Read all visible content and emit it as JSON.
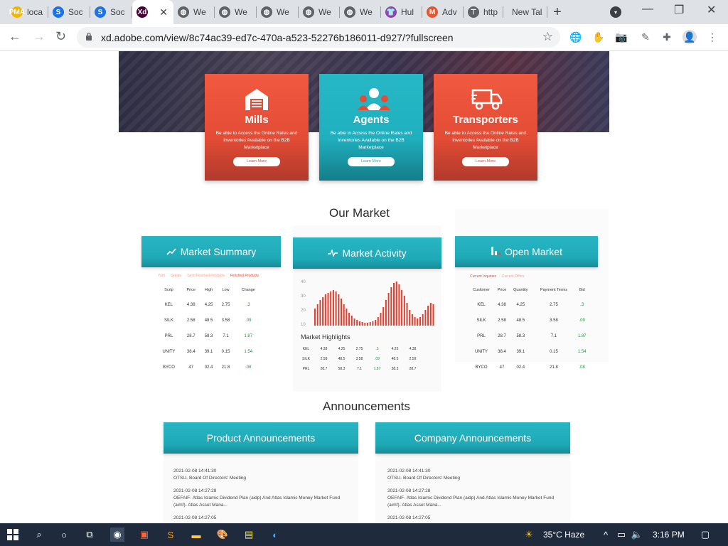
{
  "browser": {
    "tabs": [
      {
        "title": "loca",
        "icon": "pma-icon",
        "color": "#f4b400",
        "letter": "PMA"
      },
      {
        "title": "Soc",
        "icon": "s-icon",
        "color": "#1a73e8",
        "letter": "S"
      },
      {
        "title": "Soc",
        "icon": "s-icon",
        "color": "#1a73e8",
        "letter": "S"
      },
      {
        "title": "",
        "icon": "xd-icon",
        "color": "#470137",
        "letter": "Xd",
        "active": true
      },
      {
        "title": "We",
        "icon": "globe-icon",
        "color": "#5f6368",
        "letter": "◍"
      },
      {
        "title": "We",
        "icon": "globe-icon",
        "color": "#5f6368",
        "letter": "◍"
      },
      {
        "title": "We",
        "icon": "globe-icon",
        "color": "#5f6368",
        "letter": "◍"
      },
      {
        "title": "We",
        "icon": "globe-icon",
        "color": "#5f6368",
        "letter": "◍"
      },
      {
        "title": "We",
        "icon": "globe-icon",
        "color": "#5f6368",
        "letter": "◍"
      },
      {
        "title": "Hul",
        "icon": "shirt-icon",
        "color": "#8e44ad",
        "letter": "👕"
      },
      {
        "title": "Adv",
        "icon": "m-icon",
        "color": "#e4572e",
        "letter": "M"
      },
      {
        "title": "http",
        "icon": "translate-icon",
        "color": "#5f6368",
        "letter": "⊤"
      },
      {
        "title": "New Tal",
        "icon": "",
        "color": "",
        "letter": ""
      }
    ],
    "url": "xd.adobe.com/view/8c74ac39-ed7c-470a-a523-52276b186011-d927/?fullscreen"
  },
  "cards": [
    {
      "title": "Mills",
      "desc": "Be able to Access the Online Rates and Inventories Available on the B2B Marketplace",
      "button": "Learn More",
      "theme": "red"
    },
    {
      "title": "Agents",
      "desc": "Be able to Access the Online Rates and Inventories Available on the B2B Marketplace",
      "button": "Learn More",
      "theme": "teal"
    },
    {
      "title": "Transporters",
      "desc": "Be able to Access the Online Rates and Inventories Available on the B2B Marketplace",
      "button": "Learn More",
      "theme": "red"
    }
  ],
  "market": {
    "title": "Our Market",
    "summary": {
      "heading": "Market Summary",
      "subtabs": [
        "Yarn",
        "Greige",
        "Semi Finished Products",
        "Finished Products"
      ],
      "columns": [
        "Scrip",
        "Price",
        "High",
        "Low",
        "Change"
      ],
      "rows": [
        [
          "KEL",
          "4.38",
          "4.25",
          "2.75",
          ".3"
        ],
        [
          "SILK",
          "2.58",
          "48.5",
          "3.58",
          ".09"
        ],
        [
          "PRL",
          "28.7",
          "58.3",
          "7.1",
          "1.87"
        ],
        [
          "UNITY",
          "38.4",
          "39.1",
          "0.15",
          "1.54"
        ],
        [
          "BYCO",
          "47",
          "02.4",
          "21.8",
          ".08"
        ]
      ]
    },
    "activity": {
      "heading": "Market Activity",
      "yticks": [
        "40",
        "30",
        "20",
        "10"
      ],
      "highlights_title": "Market Highlights",
      "highlights": [
        [
          "KEL",
          "4.38",
          "4.25",
          "2.75",
          ".3",
          "4.25",
          "4.38"
        ],
        [
          "SILK",
          "2.58",
          "48.5",
          "3.58",
          ".09",
          "48.5",
          "2.59"
        ],
        [
          "PRL",
          "28.7",
          "58.3",
          "7.1",
          "1.87",
          "58.3",
          "28.7"
        ]
      ]
    },
    "open": {
      "heading": "Open Market",
      "subtabs": [
        "Current Inquiries",
        "Current Offers"
      ],
      "columns": [
        "Customer",
        "Price",
        "Quantity",
        "Payment Terms",
        "Bid"
      ],
      "rows": [
        [
          "KEL",
          "4.38",
          "4.25",
          "2.75",
          ".3"
        ],
        [
          "SILK",
          "2.58",
          "48.5",
          "3.58",
          ".09"
        ],
        [
          "PRL",
          "28.7",
          "58.3",
          "7.1",
          "1.87"
        ],
        [
          "UNITY",
          "38.4",
          "39.1",
          "0.15",
          "1.54"
        ],
        [
          "BYCO",
          "47",
          "02.4",
          "21.8",
          ".08"
        ]
      ]
    }
  },
  "announcements": {
    "title": "Announcements",
    "product": {
      "heading": "Product Announcements",
      "items": [
        {
          "date": "2021-02-08 14:41:30",
          "text": "OTSU- Board Of Directors' Meeting"
        },
        {
          "date": "2021-02-08 14:27:28",
          "text": "OEFAIF- Atlas Islamic Dividend Plan (aidp) And Atlas Islamic Money Market Fund (aimf)- Atlas Asset Mana..."
        },
        {
          "date": "2021-02-08 14:27:05",
          "text": ""
        }
      ]
    },
    "company": {
      "heading": "Company Announcements",
      "items": [
        {
          "date": "2021-02-08 14:41:30",
          "text": "OTSU- Board Of Directors' Meeting"
        },
        {
          "date": "2021-02-08 14:27:28",
          "text": "OEFAIF- Atlas Islamic Dividend Plan (aidp) And Atlas Islamic Money Market Fund (aimf)- Atlas Asset Mana..."
        },
        {
          "date": "2021-02-08 14:27:05",
          "text": ""
        }
      ]
    }
  },
  "taskbar": {
    "weather": "35°C  Haze",
    "time": "3:16 PM"
  },
  "colors": {
    "accent_red": "#e44c35",
    "accent_teal": "#1fb0bf",
    "change_green": "#1a9a3a"
  }
}
